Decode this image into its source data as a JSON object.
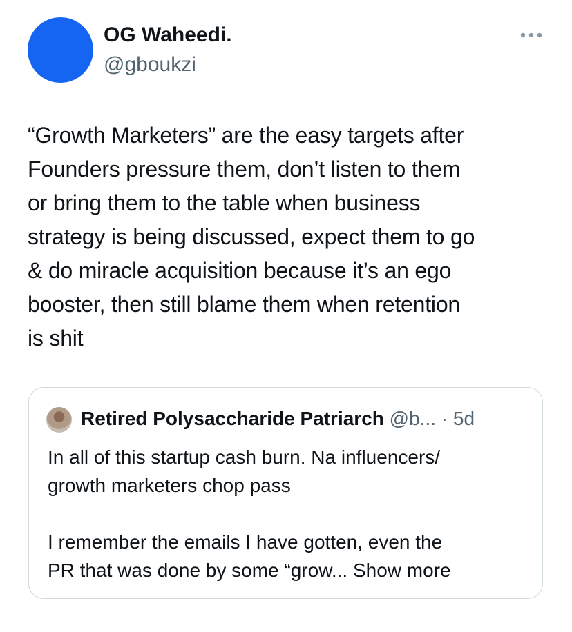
{
  "tweet": {
    "author": {
      "display_name": "OG Waheedi.",
      "handle": "@gboukzi",
      "avatar_color": "#1565f2"
    },
    "more_icon": "more-horizontal-icon",
    "text": "“Growth Marketers” are the easy targets after\nFounders pressure them, don’t listen to them\nor bring them to the table when business\nstrategy is being discussed, expect them to go\n& do miracle acquisition because it’s an ego\nbooster, then still blame them when retention\nis shit"
  },
  "quoted_tweet": {
    "display_name": "Retired Polysaccharide Patriarch",
    "handle": "@b...",
    "separator": "·",
    "time": "5d",
    "text_paragraph_1": "In all of this startup cash burn. Na influencers/\ngrowth marketers chop pass",
    "text_paragraph_2": "I remember the emails I have gotten, even the\nPR that was done by some “grow... ",
    "show_more_label": "Show more"
  },
  "colors": {
    "text_primary": "#0f1419",
    "text_secondary": "#536471",
    "border": "#cfd9de"
  }
}
